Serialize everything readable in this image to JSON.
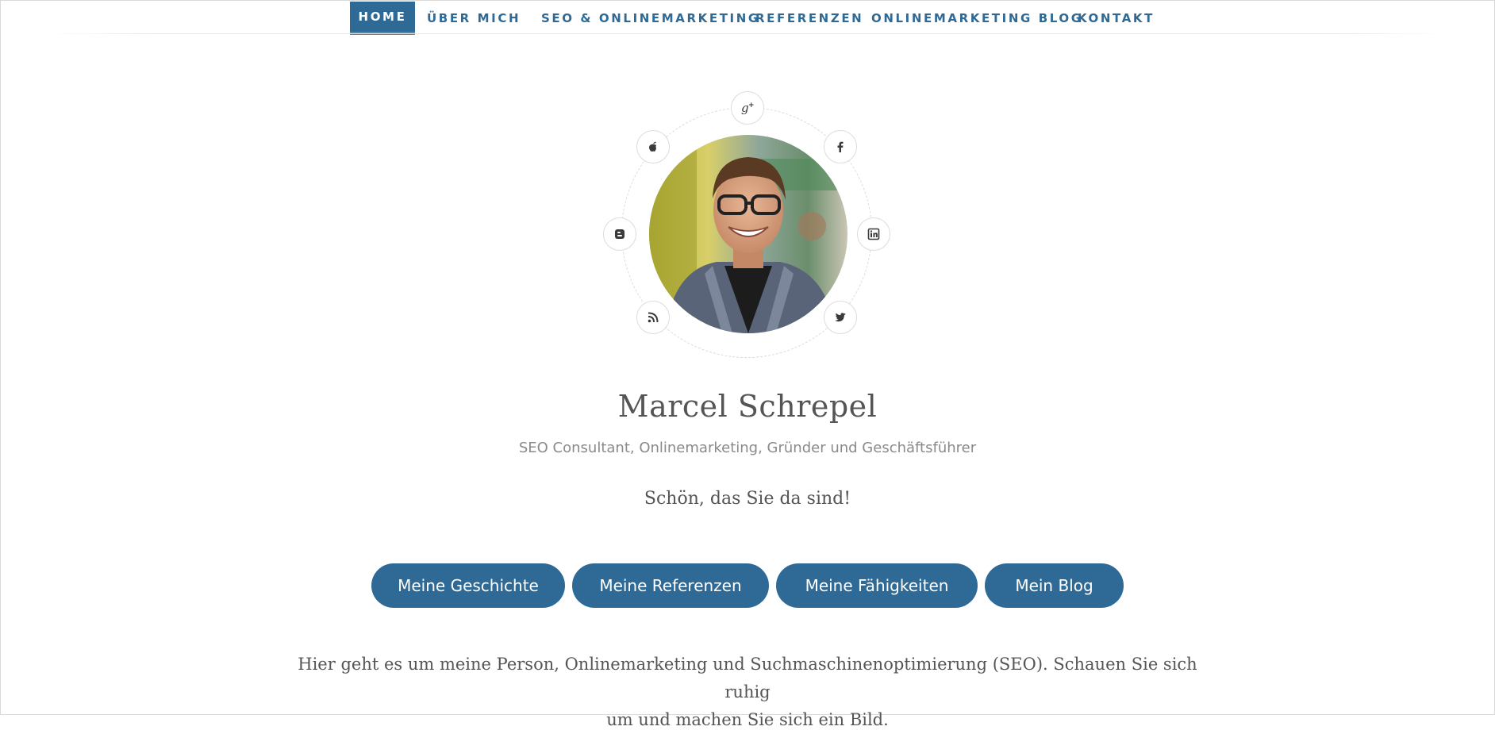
{
  "nav": {
    "items": [
      {
        "label": "HOME",
        "active": true
      },
      {
        "label": "ÜBER MICH",
        "active": false
      },
      {
        "label": "SEO & ONLINEMARKETING",
        "active": false
      },
      {
        "label": "REFERENZEN",
        "active": false
      },
      {
        "label": "ONLINEMARKETING BLOG",
        "active": false
      },
      {
        "label": "KONTAKT",
        "active": false
      }
    ]
  },
  "social": {
    "icons": [
      "google-plus-icon",
      "apple-icon",
      "facebook-icon",
      "blogger-icon",
      "linkedin-icon",
      "rss-icon",
      "twitter-icon"
    ]
  },
  "profile": {
    "name": "Marcel Schrepel",
    "subtitle": "SEO Consultant, Onlinemarketing, Gründer und Geschäftsführer",
    "greeting": "Schön, das Sie da sind!"
  },
  "buttons": [
    {
      "label": "Meine Geschichte"
    },
    {
      "label": "Meine Referenzen"
    },
    {
      "label": "Meine Fähigkeiten"
    },
    {
      "label": "Mein Blog"
    }
  ],
  "intro": {
    "line1": "Hier geht es um meine Person, Onlinemarketing und Suchmaschinenoptimierung (SEO). Schauen Sie sich ruhig",
    "line2": "um und machen Sie sich ein Bild."
  },
  "colors": {
    "accent": "#2f6a96",
    "text": "#555555",
    "muted": "#8a8a8a",
    "border": "#dcdcdc"
  }
}
